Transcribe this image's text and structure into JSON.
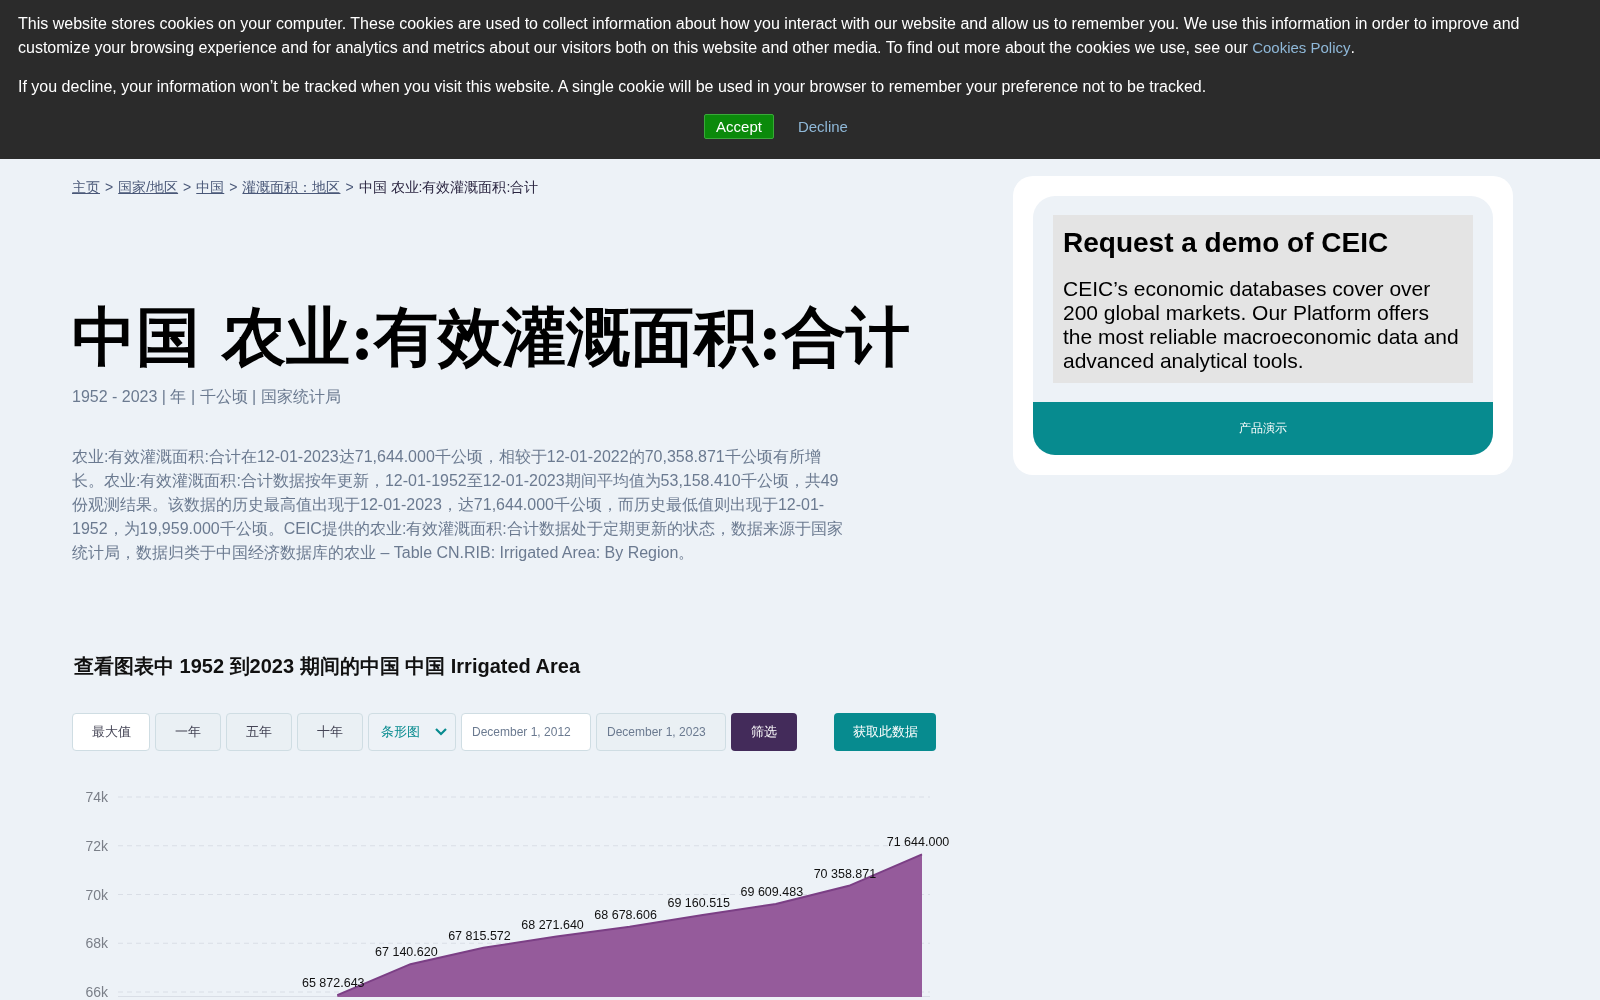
{
  "cookie_banner": {
    "paragraphs": [
      {
        "text": "This website stores cookies on your computer. These cookies are used to collect information about how you interact with our website and allow us to remember you. We use this information in order to improve and customize your browsing experience and for analytics and metrics about our visitors both on this website and other media. To find out more about the cookies we use, see our",
        "link": "Cookies Policy",
        "after": "."
      },
      {
        "text": "If you decline, your information won’t be tracked when you visit this website. A single cookie will be used in your browser to remember your preference not to be tracked."
      }
    ],
    "accept_button": "Accept",
    "decline_button": "Decline"
  },
  "breadcrumb": {
    "separator": ">",
    "items": [
      {
        "label": "主页",
        "kind": "link"
      },
      {
        "label": "国家/地区",
        "kind": "link"
      },
      {
        "label": "中国",
        "kind": "link"
      },
      {
        "label": "灌溉面积：地区",
        "kind": "link"
      },
      {
        "label": "中国 农业:有效灌溉面积:合计",
        "kind": "current"
      }
    ]
  },
  "title": "中国 农业:有效灌溉面积:合计",
  "subtitle": "1952 - 2023 | 年 | 千公顷 | 国家统计局",
  "description": "农业:有效灌溉面积:合计在12-01-2023达71,644.000千公顷，相较于12-01-2022的70,358.871千公顷有所增长。农业:有效灌溉面积:合计数据按年更新，12-01-1952至12-01-2023期间平均值为53,158.410千公顷，共49份观测结果。该数据的历史最高值出现于12-01-2023，达71,644.000千公顷，而历史最低值则出现于12-01-1952，为19,959.000千公顷。CEIC提供的农业:有效灌溉面积:合计数据处于定期更新的状态，数据来源于国家统计局，数据归类于中国经济数据库的农业 – Table CN.RIB: Irrigated Area: By Region。",
  "chart_section": {
    "title": "查看图表中 1952 到2023 期间的中国 中国 Irrigated Area",
    "range_buttons": [
      {
        "label": "最大值",
        "selected": true
      },
      {
        "label": "一年",
        "selected": false
      },
      {
        "label": "五年",
        "selected": false
      },
      {
        "label": "十年",
        "selected": false
      }
    ],
    "chart_type_select": {
      "value": "条形图"
    },
    "start_date": {
      "value": "December 1, 2012"
    },
    "end_date": {
      "value": "December 1, 2023"
    },
    "filter_button": "筛选",
    "data_button": "获取此数据",
    "chart_data": {
      "type": "area",
      "grid": true,
      "ylim": [
        65800,
        74000
      ],
      "series": [
        {
          "color": "#955b9b",
          "values": [
            null,
            null,
            null,
            65872.643,
            67140.62,
            67815.572,
            68271.64,
            68678.606,
            69160.515,
            69609.483,
            70358.871,
            71644.0
          ]
        }
      ],
      "yticks": [
        {
          "value": 66000,
          "label": "66k"
        },
        {
          "value": 68000,
          "label": "68k"
        },
        {
          "value": 70000,
          "label": "70k"
        },
        {
          "value": 72000,
          "label": "72k"
        },
        {
          "value": 74000,
          "label": "74k"
        }
      ],
      "value_labels": [
        null,
        null,
        null,
        "65 872.643",
        "67 140.620",
        "67 815.572",
        "68 271.640",
        "68 678.606",
        "69 160.515",
        "69 609.483",
        "70 358.871",
        "71 644.000"
      ]
    }
  },
  "demo_card": {
    "title": "Request a demo of CEIC",
    "body": "CEIC’s economic databases cover over 200 global markets. Our Platform offers the most reliable macroeconomic data and advanced analytical tools.",
    "button": "产品演示"
  }
}
